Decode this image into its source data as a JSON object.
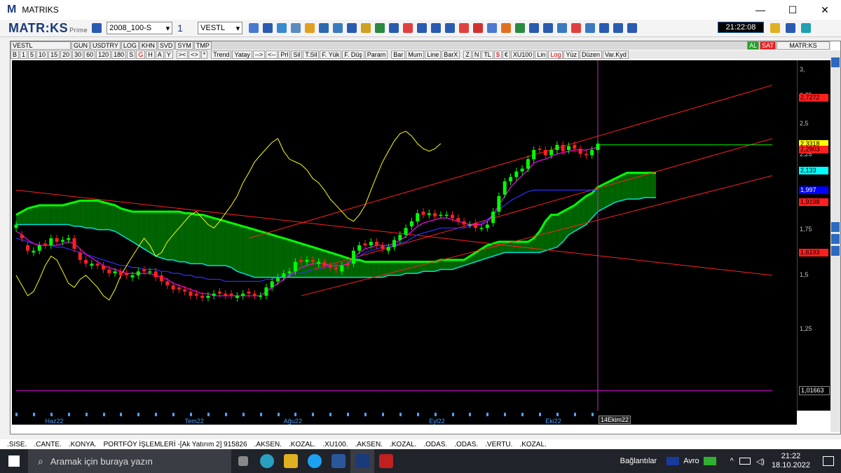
{
  "window": {
    "logo": "M",
    "title": "MATRIKS",
    "min": "—",
    "max": "☐",
    "close": "✕"
  },
  "toolbar": {
    "brand": "MATR:KS",
    "brand_sub": "Prime",
    "template": "2008_100-S",
    "layout_num": "1",
    "symbol": "VESTL",
    "clock": "21:22:08"
  },
  "chart_header": {
    "symbol": "VESTL",
    "tabs": [
      "GUN",
      "USDTRY",
      "LOG",
      "KHN",
      "SVD",
      "SYM",
      "TMP"
    ],
    "right_labels": {
      "al": "AL",
      "sat": "SAT",
      "brand": "MATR:KS"
    }
  },
  "chart_toolbar": {
    "periods": [
      "B",
      "1",
      "5",
      "10",
      "15",
      "20",
      "30",
      "60",
      "120",
      "180",
      "S",
      "G",
      "H",
      "A",
      "Y"
    ],
    "nav": [
      ">< ",
      "<>",
      "*"
    ],
    "tools": [
      "Trend",
      "Yatay",
      "-->",
      "<--",
      "Prl",
      "Sil",
      "T.Sil",
      "F. Yük",
      "F. Düş",
      "Param"
    ],
    "types": [
      "Bar",
      "Mum",
      "Line",
      "BarX"
    ],
    "misc": [
      "Z",
      "N",
      "TL",
      "$",
      "€",
      "XU100",
      "Lin",
      "Log",
      "Yüz",
      "Düzen",
      "Var.Kyd"
    ]
  },
  "chart_data": {
    "type": "candlestick",
    "symbol": "VESTL",
    "scale": "log",
    "y_ticks": [
      "3,",
      "2,75",
      "2,5",
      "2,25",
      "2",
      "1,75",
      "1,5",
      "1,25",
      "1,01663"
    ],
    "y_tick_values": [
      3.0,
      2.75,
      2.5,
      2.25,
      2.0,
      1.75,
      1.5,
      1.25,
      1.01663
    ],
    "ylim": [
      0.95,
      3.1
    ],
    "price_flags": [
      {
        "label": "2,7272",
        "value": 2.7272,
        "color": "#ff2020",
        "text_color": "#000000"
      },
      {
        "label": "2,3318",
        "value": 2.3318,
        "color": "#ffff00",
        "text_color": "#000000"
      },
      {
        "label": "2,2903",
        "value": 2.2903,
        "color": "#ff2020",
        "text_color": "#000000"
      },
      {
        "label": "2,133",
        "value": 2.133,
        "color": "#00ffff",
        "text_color": "#000000"
      },
      {
        "label": "1,997",
        "value": 1.997,
        "color": "#0000ff",
        "text_color": "#ffffff"
      },
      {
        "label": "1,9198",
        "value": 1.9198,
        "color": "#ff2020",
        "text_color": "#000000"
      },
      {
        "label": "1,6193",
        "value": 1.6193,
        "color": "#ff2020",
        "text_color": "#000000"
      },
      {
        "label": "1,01663",
        "value": 1.01663,
        "color": "#000000",
        "text_color": "#ffffff"
      }
    ],
    "x_labels": [
      "Haz22",
      "Tem22",
      "Ağu22",
      "Eyl22",
      "Eki22"
    ],
    "x_label_index": [
      5,
      29,
      46,
      71,
      91
    ],
    "cursor_label": "14Ekim22",
    "cursor_index": 100,
    "candles_close": [
      1.78,
      1.7,
      1.63,
      1.63,
      1.66,
      1.66,
      1.7,
      1.68,
      1.69,
      1.7,
      1.64,
      1.58,
      1.56,
      1.56,
      1.55,
      1.53,
      1.51,
      1.52,
      1.5,
      1.5,
      1.5,
      1.52,
      1.52,
      1.52,
      1.49,
      1.47,
      1.45,
      1.43,
      1.43,
      1.42,
      1.4,
      1.4,
      1.39,
      1.4,
      1.41,
      1.41,
      1.4,
      1.4,
      1.4,
      1.41,
      1.41,
      1.4,
      1.4,
      1.44,
      1.47,
      1.49,
      1.51,
      1.52,
      1.57,
      1.57,
      1.58,
      1.57,
      1.57,
      1.55,
      1.54,
      1.53,
      1.55,
      1.55,
      1.63,
      1.66,
      1.66,
      1.68,
      1.66,
      1.64,
      1.65,
      1.69,
      1.72,
      1.76,
      1.8,
      1.85,
      1.84,
      1.85,
      1.83,
      1.84,
      1.84,
      1.82,
      1.8,
      1.78,
      1.78,
      1.76,
      1.76,
      1.78,
      1.86,
      1.96,
      2.06,
      2.09,
      2.13,
      2.15,
      2.22,
      2.29,
      2.29,
      2.25,
      2.29,
      2.33,
      2.28,
      2.32,
      2.3,
      2.26,
      2.25,
      2.29,
      2.34
    ],
    "candles_open": [
      1.76,
      1.72,
      1.66,
      1.62,
      1.63,
      1.67,
      1.66,
      1.7,
      1.68,
      1.69,
      1.7,
      1.62,
      1.58,
      1.55,
      1.56,
      1.55,
      1.53,
      1.51,
      1.52,
      1.51,
      1.49,
      1.5,
      1.53,
      1.52,
      1.52,
      1.5,
      1.47,
      1.45,
      1.44,
      1.43,
      1.42,
      1.41,
      1.4,
      1.39,
      1.4,
      1.42,
      1.41,
      1.41,
      1.39,
      1.4,
      1.42,
      1.41,
      1.4,
      1.4,
      1.44,
      1.47,
      1.49,
      1.51,
      1.52,
      1.58,
      1.57,
      1.58,
      1.56,
      1.57,
      1.55,
      1.54,
      1.52,
      1.56,
      1.56,
      1.63,
      1.67,
      1.66,
      1.68,
      1.66,
      1.63,
      1.65,
      1.69,
      1.72,
      1.77,
      1.8,
      1.86,
      1.84,
      1.85,
      1.84,
      1.84,
      1.84,
      1.82,
      1.8,
      1.78,
      1.79,
      1.76,
      1.76,
      1.79,
      1.86,
      1.97,
      2.06,
      2.09,
      2.13,
      2.15,
      2.22,
      2.3,
      2.29,
      2.25,
      2.29,
      2.33,
      2.29,
      2.33,
      2.3,
      2.26,
      2.25,
      2.29
    ],
    "tenkan": [
      1.74,
      1.72,
      1.69,
      1.67,
      1.66,
      1.66,
      1.66,
      1.66,
      1.67,
      1.68,
      1.67,
      1.64,
      1.61,
      1.59,
      1.57,
      1.55,
      1.54,
      1.53,
      1.52,
      1.51,
      1.51,
      1.51,
      1.51,
      1.51,
      1.5,
      1.49,
      1.48,
      1.46,
      1.45,
      1.44,
      1.43,
      1.42,
      1.41,
      1.41,
      1.4,
      1.4,
      1.4,
      1.4,
      1.4,
      1.4,
      1.4,
      1.4,
      1.4,
      1.42,
      1.44,
      1.46,
      1.48,
      1.5,
      1.52,
      1.54,
      1.55,
      1.56,
      1.56,
      1.56,
      1.55,
      1.55,
      1.55,
      1.56,
      1.59,
      1.62,
      1.64,
      1.65,
      1.66,
      1.66,
      1.66,
      1.67,
      1.69,
      1.71,
      1.74,
      1.77,
      1.79,
      1.8,
      1.81,
      1.82,
      1.82,
      1.81,
      1.8,
      1.79,
      1.78,
      1.78,
      1.78,
      1.8,
      1.84,
      1.9,
      1.96,
      2.02,
      2.06,
      2.1,
      2.14,
      2.19,
      2.21,
      2.22,
      2.24,
      2.26,
      2.27,
      2.28,
      2.29,
      2.29,
      2.29,
      2.3,
      2.31
    ],
    "kijun": [
      1.7,
      1.69,
      1.68,
      1.67,
      1.66,
      1.66,
      1.66,
      1.65,
      1.65,
      1.64,
      1.63,
      1.62,
      1.61,
      1.6,
      1.59,
      1.58,
      1.57,
      1.56,
      1.55,
      1.55,
      1.54,
      1.54,
      1.53,
      1.53,
      1.53,
      1.52,
      1.52,
      1.51,
      1.51,
      1.5,
      1.5,
      1.49,
      1.49,
      1.48,
      1.48,
      1.48,
      1.47,
      1.47,
      1.47,
      1.47,
      1.47,
      1.47,
      1.47,
      1.48,
      1.48,
      1.49,
      1.5,
      1.5,
      1.51,
      1.51,
      1.52,
      1.53,
      1.53,
      1.54,
      1.55,
      1.55,
      1.55,
      1.56,
      1.58,
      1.6,
      1.62,
      1.63,
      1.64,
      1.65,
      1.65,
      1.66,
      1.67,
      1.68,
      1.7,
      1.72,
      1.73,
      1.74,
      1.75,
      1.76,
      1.76,
      1.76,
      1.76,
      1.76,
      1.77,
      1.78,
      1.79,
      1.81,
      1.84,
      1.87,
      1.9,
      1.93,
      1.95,
      1.97,
      1.99,
      2.0,
      2.0,
      2.0,
      2.0,
      2.0,
      2.0,
      2.0,
      2.0,
      2.0,
      2.0,
      2.0,
      2.0
    ],
    "chikou": [
      1.5,
      1.45,
      1.4,
      1.42,
      1.48,
      1.55,
      1.6,
      1.58,
      1.52,
      1.46,
      1.44,
      1.48,
      1.5,
      1.47,
      1.44,
      1.4,
      1.38,
      1.43,
      1.5,
      1.55,
      1.6,
      1.65,
      1.7,
      1.66,
      1.6,
      1.62,
      1.68,
      1.72,
      1.76,
      1.8,
      1.84,
      1.86,
      1.82,
      1.78,
      1.76,
      1.8,
      1.85,
      1.9,
      1.96,
      2.05,
      2.12,
      2.2,
      2.25,
      2.3,
      2.35,
      2.38,
      2.28,
      2.22,
      2.2,
      2.18,
      2.14,
      2.08,
      2.05,
      2.0,
      1.94,
      1.9,
      1.86,
      1.82,
      1.8,
      1.84,
      1.9,
      2.0,
      2.1,
      2.2,
      2.28,
      2.36,
      2.42,
      2.44,
      2.4,
      2.34,
      2.3,
      2.28,
      2.3,
      2.34
    ],
    "senkou_a": [
      1.84,
      1.86,
      1.88,
      1.89,
      1.9,
      1.9,
      1.9,
      1.9,
      1.9,
      1.91,
      1.92,
      1.93,
      1.93,
      1.93,
      1.93,
      1.92,
      1.91,
      1.9,
      1.88,
      1.87,
      1.86,
      1.86,
      1.86,
      1.86,
      1.86,
      1.86,
      1.86,
      1.86,
      1.86,
      1.85,
      1.85,
      1.84,
      1.84,
      1.83,
      1.82,
      1.81,
      1.8,
      1.79,
      1.78,
      1.77,
      1.76,
      1.75,
      1.74,
      1.73,
      1.72,
      1.71,
      1.7,
      1.69,
      1.68,
      1.67,
      1.66,
      1.65,
      1.64,
      1.63,
      1.62,
      1.61,
      1.6,
      1.59,
      1.58,
      1.58,
      1.57,
      1.57,
      1.57,
      1.57,
      1.57,
      1.57,
      1.57,
      1.57,
      1.57,
      1.57,
      1.57,
      1.57,
      1.57,
      1.58,
      1.58,
      1.58,
      1.58,
      1.58,
      1.6,
      1.62,
      1.64,
      1.66,
      1.67,
      1.68,
      1.68,
      1.68,
      1.68,
      1.68,
      1.68,
      1.7,
      1.74,
      1.8,
      1.84,
      1.84,
      1.86,
      1.88,
      1.9,
      1.93,
      1.96,
      1.98,
      2.02,
      2.04,
      2.06,
      2.08,
      2.1,
      2.12,
      2.12,
      2.12,
      2.12,
      2.12,
      2.12
    ],
    "senkou_b": [
      1.78,
      1.78,
      1.78,
      1.78,
      1.78,
      1.78,
      1.78,
      1.78,
      1.78,
      1.78,
      1.77,
      1.77,
      1.76,
      1.76,
      1.75,
      1.75,
      1.75,
      1.74,
      1.72,
      1.7,
      1.68,
      1.66,
      1.64,
      1.62,
      1.6,
      1.59,
      1.58,
      1.58,
      1.57,
      1.57,
      1.56,
      1.56,
      1.56,
      1.55,
      1.55,
      1.55,
      1.55,
      1.54,
      1.52,
      1.51,
      1.5,
      1.49,
      1.49,
      1.49,
      1.49,
      1.49,
      1.49,
      1.49,
      1.49,
      1.49,
      1.49,
      1.49,
      1.49,
      1.49,
      1.49,
      1.49,
      1.49,
      1.49,
      1.49,
      1.49,
      1.49,
      1.49,
      1.49,
      1.49,
      1.5,
      1.5,
      1.5,
      1.51,
      1.51,
      1.51,
      1.52,
      1.52,
      1.52,
      1.53,
      1.53,
      1.53,
      1.54,
      1.55,
      1.56,
      1.57,
      1.58,
      1.59,
      1.6,
      1.61,
      1.62,
      1.62,
      1.62,
      1.62,
      1.62,
      1.62,
      1.62,
      1.63,
      1.64,
      1.65,
      1.68,
      1.72,
      1.74,
      1.76,
      1.78,
      1.82,
      1.86,
      1.88,
      1.9,
      1.92,
      1.93,
      1.94,
      1.94,
      1.94,
      1.95,
      1.95,
      1.95
    ],
    "lines": [
      {
        "name": "channel-upper",
        "color": "#ff2020",
        "points": [
          [
            40,
            1.7
          ],
          [
            130,
            2.85
          ]
        ]
      },
      {
        "name": "channel-middle",
        "color": "#ff2020",
        "points": [
          [
            51,
            1.53
          ],
          [
            130,
            2.38
          ]
        ]
      },
      {
        "name": "channel-lower",
        "color": "#ff2020",
        "points": [
          [
            49,
            1.4
          ],
          [
            130,
            2.1
          ]
        ]
      },
      {
        "name": "downtrend",
        "color": "#ff2020",
        "points": [
          [
            0,
            2.0
          ],
          [
            130,
            1.5
          ]
        ]
      },
      {
        "name": "horizontal-level",
        "color": "#00ff00",
        "points": [
          [
            100,
            2.33
          ],
          [
            130,
            2.33
          ]
        ]
      },
      {
        "name": "mag-level",
        "color": "#d000d0",
        "points": [
          [
            0,
            1.01663
          ],
          [
            130,
            1.01663
          ]
        ]
      }
    ],
    "colors": {
      "cloud_bull": "#006400",
      "cloud_bear": "#8b0000",
      "tenkan": "#ff00ff",
      "kijun": "#3030ff",
      "chikou": "#ffff00",
      "senkou_a": "#00ff00",
      "senkou_b": "#00e0e0",
      "up": "#00ff00",
      "down": "#ff2020"
    }
  },
  "taskstrip": [
    ".SISE.",
    ".CANTE.",
    ".KONYA.",
    "PORTFÖY İŞLEMLERİ -[Ak Yatırım 2] 915826",
    ".AKSEN.",
    ".KOZAL.",
    ".XU100.",
    ".AKSEN.",
    ".KOZAL.",
    ".ODAS.",
    ".ODAS.",
    ".VERTU.",
    ".KOZAL."
  ],
  "taskbar": {
    "search_placeholder": "Aramak için buraya yazın",
    "connections": "Bağlantılar",
    "currency": "Avro",
    "time": "21:22",
    "date": "18.10.2022"
  }
}
